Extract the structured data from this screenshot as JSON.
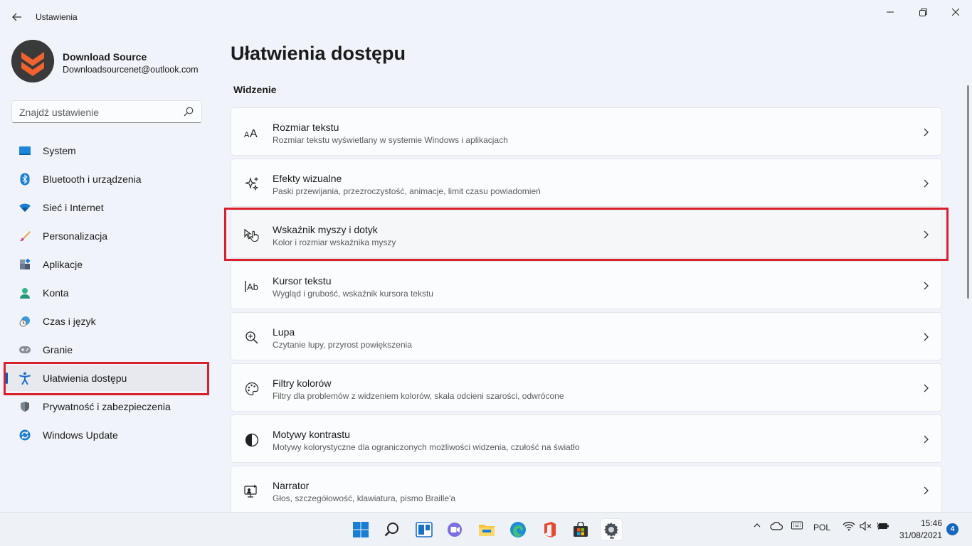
{
  "window": {
    "title": "Ustawienia"
  },
  "profile": {
    "name": "Download Source",
    "email": "Downloadsourcenet@outlook.com"
  },
  "search": {
    "placeholder": "Znajdź ustawienie"
  },
  "sidebar": {
    "items": [
      {
        "label": "System",
        "icon": "system-icon"
      },
      {
        "label": "Bluetooth i urządzenia",
        "icon": "bluetooth-icon"
      },
      {
        "label": "Sieć i Internet",
        "icon": "wifi-icon"
      },
      {
        "label": "Personalizacja",
        "icon": "brush-icon"
      },
      {
        "label": "Aplikacje",
        "icon": "apps-icon"
      },
      {
        "label": "Konta",
        "icon": "account-icon"
      },
      {
        "label": "Czas i język",
        "icon": "clock-globe-icon"
      },
      {
        "label": "Granie",
        "icon": "gamepad-icon"
      },
      {
        "label": "Ułatwienia dostępu",
        "icon": "accessibility-icon",
        "active": true
      },
      {
        "label": "Prywatność i zabezpieczenia",
        "icon": "shield-icon"
      },
      {
        "label": "Windows Update",
        "icon": "update-icon"
      }
    ]
  },
  "main": {
    "title": "Ułatwienia dostępu",
    "section": "Widzenie",
    "cards": [
      {
        "title": "Rozmiar tekstu",
        "desc": "Rozmiar tekstu wyświetlany w systemie Windows i aplikacjach",
        "icon": "text-size-icon"
      },
      {
        "title": "Efekty wizualne",
        "desc": "Paski przewijania, przezroczystość, animacje, limit czasu powiadomień",
        "icon": "sparkle-icon"
      },
      {
        "title": "Wskaźnik myszy i dotyk",
        "desc": "Kolor i rozmiar wskaźnika myszy",
        "icon": "mouse-pointer-icon"
      },
      {
        "title": "Kursor tekstu",
        "desc": "Wygląd i grubość, wskaźnik kursora tekstu",
        "icon": "text-cursor-icon"
      },
      {
        "title": "Lupa",
        "desc": "Czytanie lupy, przyrost powiększenia",
        "icon": "magnifier-icon"
      },
      {
        "title": "Filtry kolorów",
        "desc": "Filtry dla problemów z widzeniem kolorów, skala odcieni szarości, odwrócone",
        "icon": "palette-icon"
      },
      {
        "title": "Motywy kontrastu",
        "desc": "Motywy kolorystyczne dla ograniczonych możliwości widzenia, czułość na światło",
        "icon": "contrast-icon"
      },
      {
        "title": "Narrator",
        "desc": "Głos, szczegółowość, klawiatura, pismo Braille'a",
        "icon": "narrator-icon"
      }
    ]
  },
  "taskbar": {
    "language": "POL",
    "time": "15:46",
    "date": "31/08/2021",
    "notifications": "4"
  },
  "colors": {
    "accent": "#005fb8",
    "highlight": "#d9202d"
  }
}
